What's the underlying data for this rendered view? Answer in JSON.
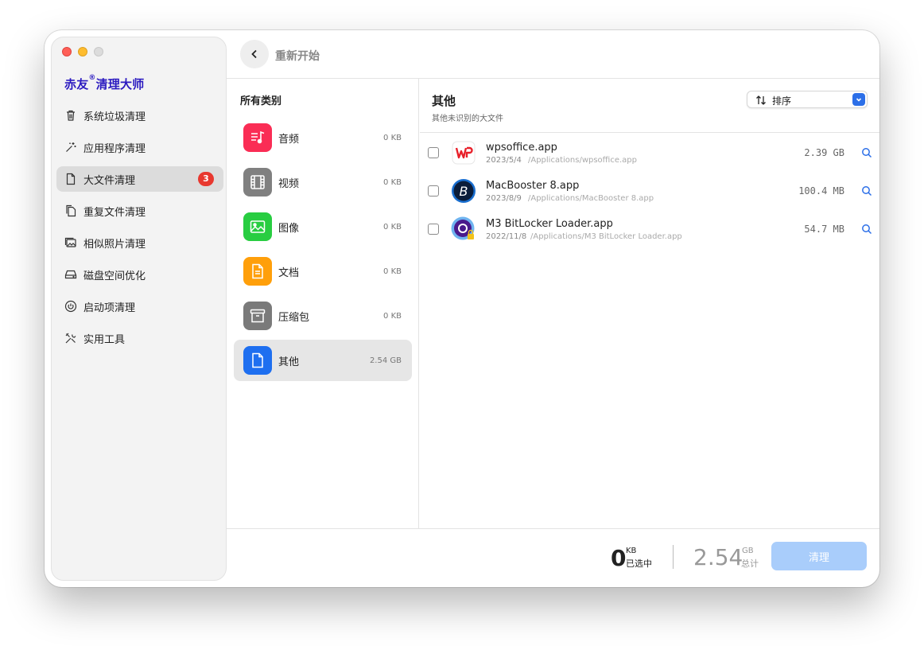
{
  "sidebar": {
    "brand": {
      "prefix": "赤友",
      "mark": "®",
      "suffix": "清理大师"
    },
    "items": [
      {
        "label": "系统垃圾清理",
        "icon": "trash-icon"
      },
      {
        "label": "应用程序清理",
        "icon": "magic-wand-icon"
      },
      {
        "label": "大文件清理",
        "icon": "file-icon",
        "badge": "3",
        "active": true
      },
      {
        "label": "重复文件清理",
        "icon": "duplicate-files-icon"
      },
      {
        "label": "相似照片清理",
        "icon": "photos-icon"
      },
      {
        "label": "磁盘空间优化",
        "icon": "disk-icon"
      },
      {
        "label": "启动项清理",
        "icon": "power-icon"
      },
      {
        "label": "实用工具",
        "icon": "tools-icon"
      }
    ]
  },
  "topbar": {
    "title": "重新开始",
    "back_icon": "chevron-left-icon"
  },
  "categories": {
    "header": "所有类别",
    "items": [
      {
        "name": "音频",
        "size": "0 KB",
        "icon": "music-icon",
        "color": "#fa2d55"
      },
      {
        "name": "视频",
        "size": "0 KB",
        "icon": "film-icon",
        "color": "#808080"
      },
      {
        "name": "图像",
        "size": "0 KB",
        "icon": "image-icon",
        "color": "#28cd41"
      },
      {
        "name": "文档",
        "size": "0 KB",
        "icon": "document-icon",
        "color": "#ff9f0a"
      },
      {
        "name": "压缩包",
        "size": "0 KB",
        "icon": "archive-icon",
        "color": "#7a7a7a"
      },
      {
        "name": "其他",
        "size": "2.54 GB",
        "icon": "file-icon",
        "color": "#1e6ff0",
        "active": true
      }
    ]
  },
  "content": {
    "title": "其他",
    "subtitle": "其他未识别的大文件",
    "sort_label": "排序",
    "files": [
      {
        "name": "wpsoffice.app",
        "date": "2023/5/4",
        "path": "/Applications/wpsoffice.app",
        "size": "2.39 GB",
        "icon": "wps-office-icon"
      },
      {
        "name": "MacBooster 8.app",
        "date": "2023/8/9",
        "path": "/Applications/MacBooster 8.app",
        "size": "100.4 MB",
        "icon": "macbooster-icon"
      },
      {
        "name": "M3 BitLocker Loader.app",
        "date": "2022/11/8",
        "path": "/Applications/M3 BitLocker Loader.app",
        "size": "54.7 MB",
        "icon": "bitlocker-loader-icon"
      }
    ]
  },
  "footer": {
    "selected_value": "0",
    "selected_unit": "KB",
    "selected_label": "已选中",
    "total_value": "2.54",
    "total_unit": "GB",
    "total_label": "总计",
    "clean_label": "清理"
  },
  "colors": {
    "accent": "#2c6fe8",
    "badge": "#e8382f",
    "brand": "#2b1ac0",
    "clean_button_disabled": "#a9cdfb"
  }
}
